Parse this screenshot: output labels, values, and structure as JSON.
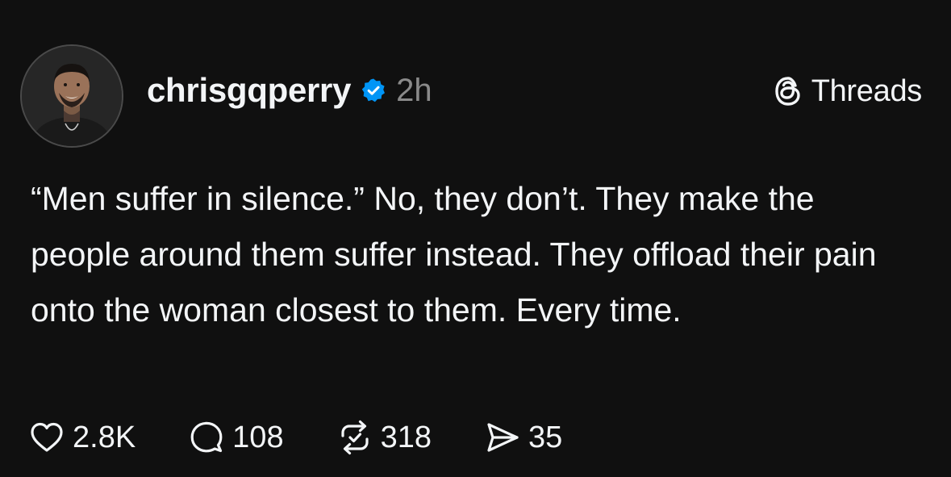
{
  "post": {
    "author": {
      "username": "chrisgqperry",
      "verified": true,
      "verified_color": "#0095f6"
    },
    "timestamp": "2h",
    "brand": {
      "label": "Threads",
      "icon": "threads-logo-icon"
    },
    "text": "“Men suffer in silence.” No, they don’t. They make the  people around them suffer instead. They offload their pain onto the woman closest to them. Every time.",
    "actions": [
      {
        "icon": "heart-icon",
        "count": "2.8K"
      },
      {
        "icon": "comment-icon",
        "count": "108"
      },
      {
        "icon": "repost-icon",
        "count": "318"
      },
      {
        "icon": "share-icon",
        "count": "35"
      }
    ]
  }
}
